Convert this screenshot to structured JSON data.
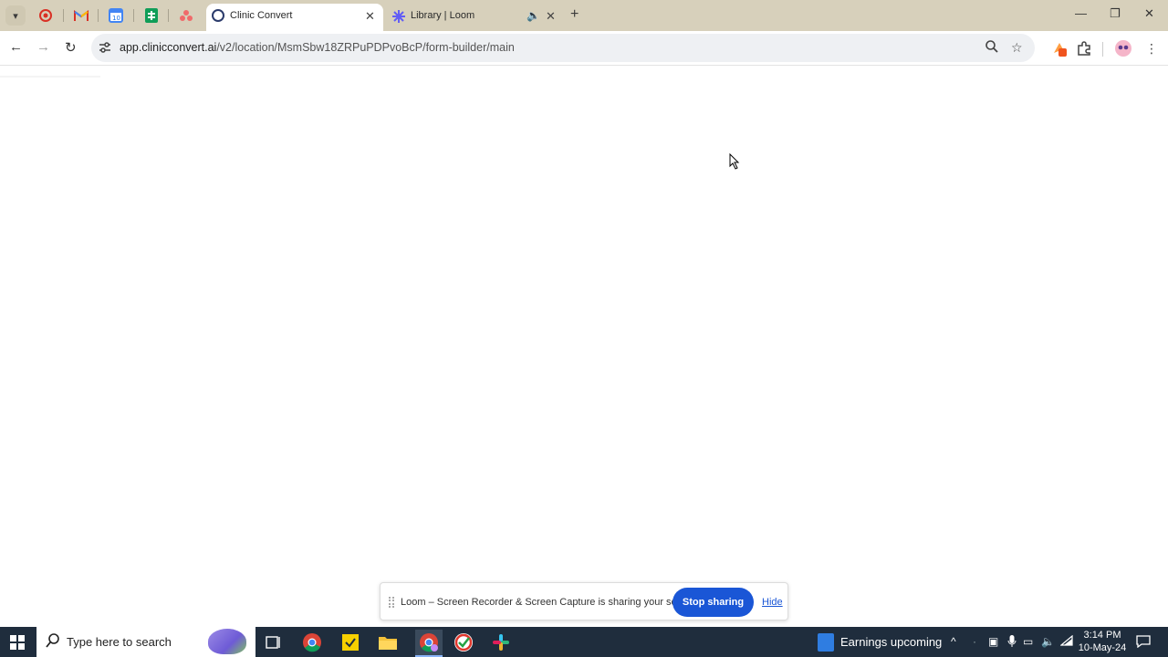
{
  "browser": {
    "tabs": [
      {
        "title": "Clinic Convert",
        "active": true
      },
      {
        "title": "Library | Loom",
        "active": false
      }
    ],
    "pinned_tabs": [
      "record-icon",
      "gmail-icon",
      "calendar-icon",
      "sheets-icon",
      "asana-icon"
    ],
    "address": {
      "host": "app.clinicconvert.ai",
      "path": "/v2/location/MsmSbw18ZRPuPDPvoBcP/form-builder/main"
    }
  },
  "loom_bar": {
    "message": "Loom – Screen Recorder & Screen Capture is sharing your screen.",
    "stop_label": "Stop sharing",
    "hide_label": "Hide"
  },
  "taskbar": {
    "search_placeholder": "Type here to search",
    "news": "Earnings upcoming",
    "time": "3:14 PM",
    "date": "10-May-24"
  },
  "colors": {
    "tabstrip": "#d7d0bb",
    "accent": "#1a56d6",
    "taskbar": "#1f2d3d"
  }
}
